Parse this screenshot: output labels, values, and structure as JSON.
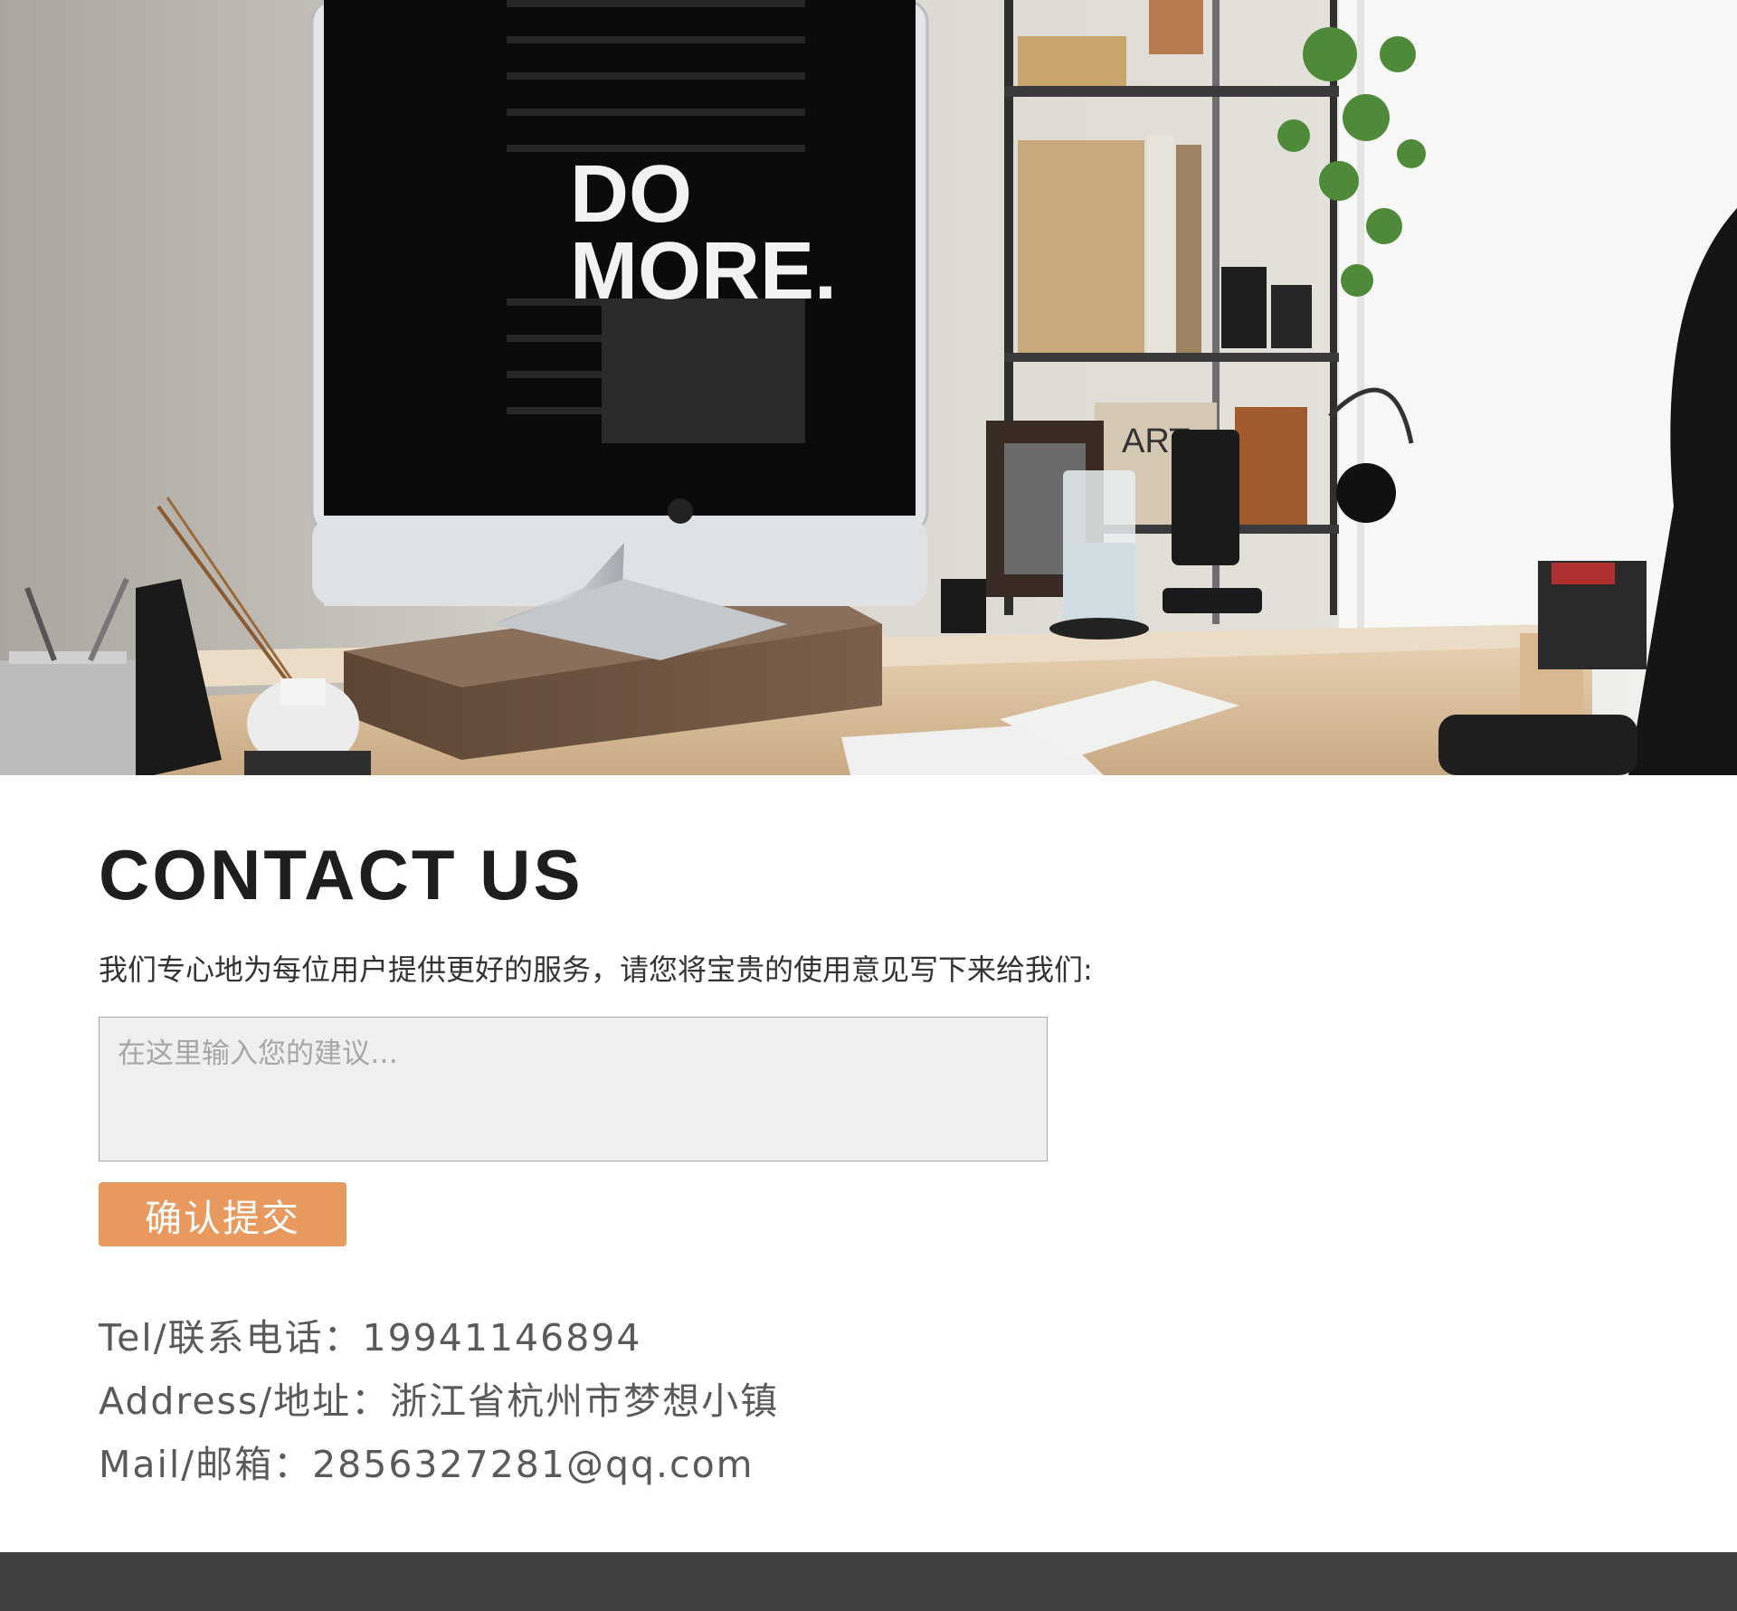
{
  "hero": {
    "screen_text_line1": "DO",
    "screen_text_line2": "MORE.",
    "book_text": "ART"
  },
  "contact": {
    "title": "CONTACT US",
    "intro": "我们专心地为每位用户提供更好的服务，请您将宝贵的使用意见写下来给我们:",
    "textarea_placeholder": "在这里输入您的建议…",
    "submit_label": "确认提交"
  },
  "info": {
    "tel": "Tel/联系电话：19941146894",
    "address": "Address/地址：浙江省杭州市梦想小镇",
    "mail": "Mail/邮箱：2856327281@qq.com"
  },
  "colors": {
    "accent": "#e89a5e",
    "footer": "#404040",
    "title": "#1e1e1e",
    "info_text": "#5a5a5a"
  }
}
